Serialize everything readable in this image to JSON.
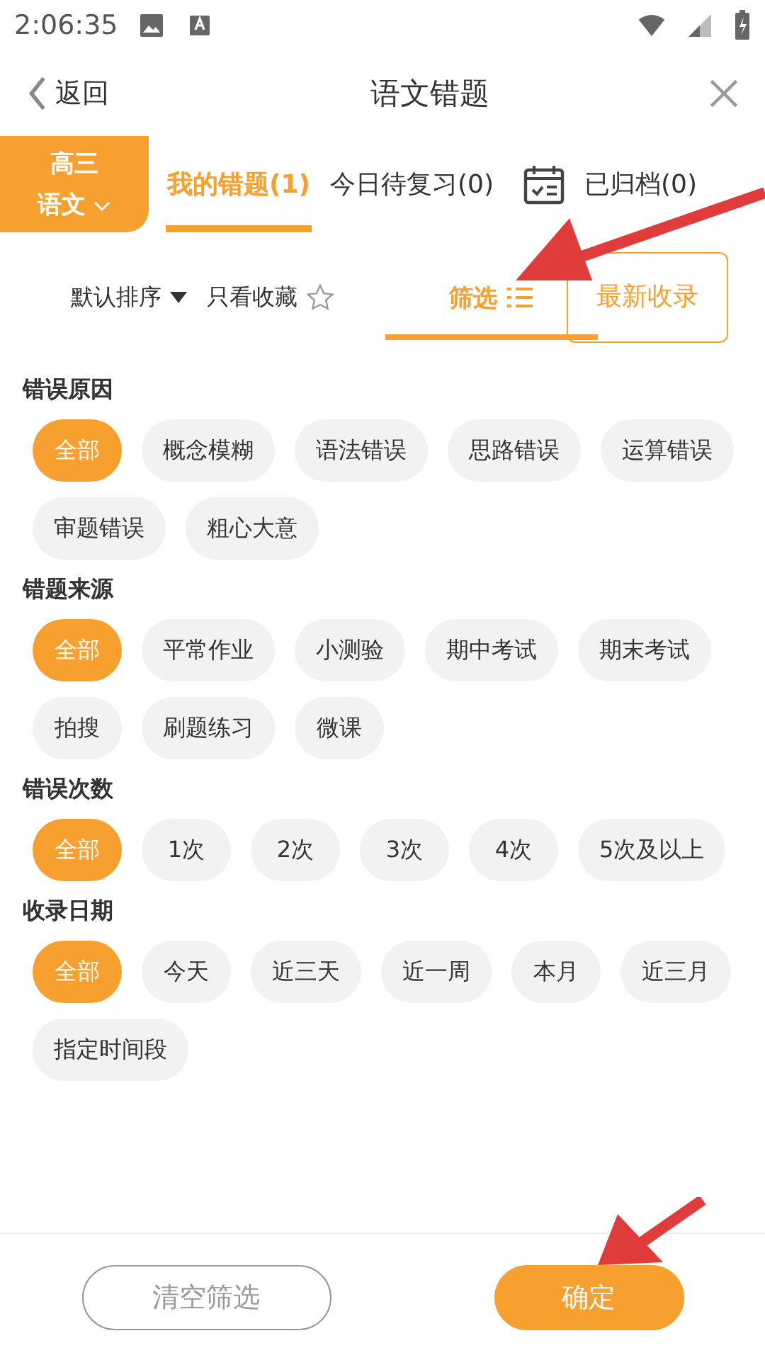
{
  "status_bar": {
    "time": "2:06:35"
  },
  "header": {
    "back": "返回",
    "title": "语文错题"
  },
  "grade_picker": {
    "grade": "高三",
    "subject": "语文"
  },
  "tabs": [
    {
      "label": "我的错题(1)",
      "selected": true
    },
    {
      "label": "今日待复习(0)",
      "selected": false
    },
    {
      "label": "已归档(0)",
      "selected": false
    }
  ],
  "toolbar": {
    "sort": "默认排序",
    "favorites": "只看收藏",
    "filter": "筛选",
    "filter_selected": true,
    "latest": "最新收录"
  },
  "sections": [
    {
      "title": "错误原因",
      "options": [
        {
          "label": "全部",
          "selected": true
        },
        {
          "label": "概念模糊",
          "selected": false
        },
        {
          "label": "语法错误",
          "selected": false
        },
        {
          "label": "思路错误",
          "selected": false
        },
        {
          "label": "运算错误",
          "selected": false
        },
        {
          "label": "审题错误",
          "selected": false
        },
        {
          "label": "粗心大意",
          "selected": false
        }
      ]
    },
    {
      "title": "错题来源",
      "options": [
        {
          "label": "全部",
          "selected": true
        },
        {
          "label": "平常作业",
          "selected": false
        },
        {
          "label": "小测验",
          "selected": false
        },
        {
          "label": "期中考试",
          "selected": false
        },
        {
          "label": "期末考试",
          "selected": false
        },
        {
          "label": "拍搜",
          "selected": false
        },
        {
          "label": "刷题练习",
          "selected": false
        },
        {
          "label": "微课",
          "selected": false
        }
      ]
    },
    {
      "title": "错误次数",
      "options": [
        {
          "label": "全部",
          "selected": true
        },
        {
          "label": "1次",
          "selected": false
        },
        {
          "label": "2次",
          "selected": false
        },
        {
          "label": "3次",
          "selected": false
        },
        {
          "label": "4次",
          "selected": false
        },
        {
          "label": "5次及以上",
          "selected": false
        }
      ]
    },
    {
      "title": "收录日期",
      "options": [
        {
          "label": "全部",
          "selected": true
        },
        {
          "label": "今天",
          "selected": false
        },
        {
          "label": "近三天",
          "selected": false
        },
        {
          "label": "近一周",
          "selected": false
        },
        {
          "label": "本月",
          "selected": false
        },
        {
          "label": "近三月",
          "selected": false
        },
        {
          "label": "指定时间段",
          "selected": false
        }
      ]
    }
  ],
  "footer": {
    "clear": "清空筛选",
    "confirm": "确定"
  }
}
